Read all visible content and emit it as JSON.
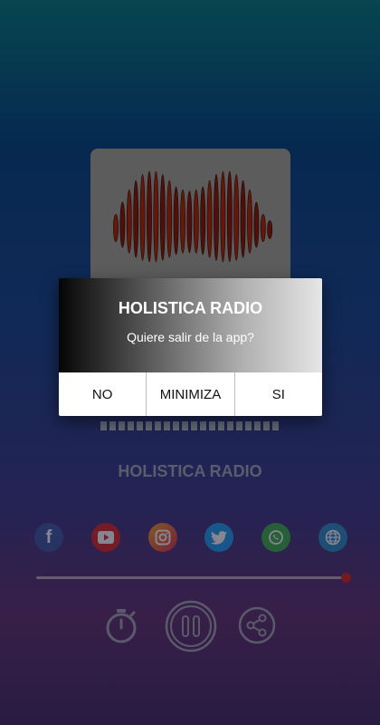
{
  "player": {
    "station_name": "HOLISTICA RADIO",
    "progress": 1.0,
    "accent_color": "#b4282e"
  },
  "socials": [
    {
      "icon": "facebook-icon",
      "glyph": "f",
      "color": "#3b5aa4"
    },
    {
      "icon": "youtube-icon",
      "glyph": "▶",
      "color": "#d82a2a"
    },
    {
      "icon": "instagram-icon",
      "glyph": "◎",
      "color": "#e36b3d"
    },
    {
      "icon": "twitter-icon",
      "glyph": "🐦",
      "color": "#1da1f2"
    },
    {
      "icon": "whatsapp-icon",
      "glyph": "✆",
      "color": "#3bb44a"
    },
    {
      "icon": "globe-icon",
      "glyph": "🌐",
      "color": "#2b8fc7"
    }
  ],
  "dialog": {
    "title": "HOLISTICA RADIO",
    "message": "Quiere salir de la app?",
    "buttons": {
      "no": "NO",
      "minimize": "MINIMIZA",
      "yes": "SI"
    }
  }
}
